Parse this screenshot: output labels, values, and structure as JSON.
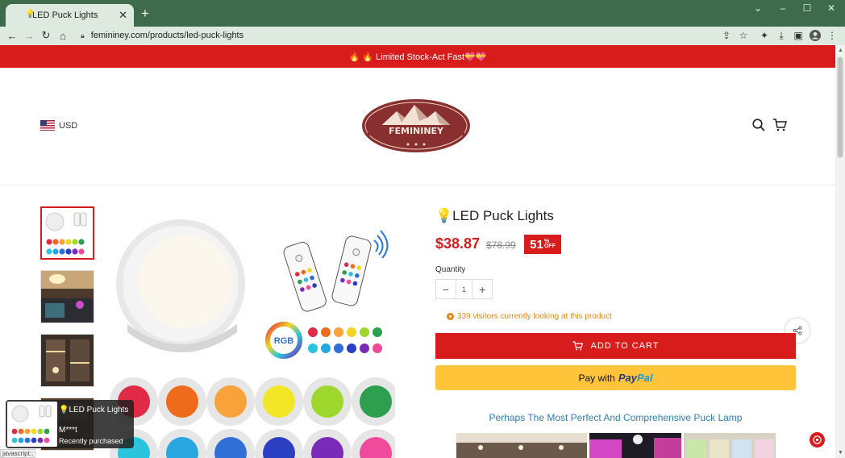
{
  "browser": {
    "tab_title": "LED Puck Lights",
    "tab_favicon": "💡",
    "url": "femininey.com/products/led-puck-lights",
    "status_text": "javascript:;"
  },
  "announcement": {
    "text": "🔥 🔥 Limited Stock-Act Fast💝💝"
  },
  "header": {
    "currency": "USD",
    "logo_text": "FEMININEY"
  },
  "product": {
    "title_icon": "💡",
    "title": "LED Puck Lights",
    "price": "$38.87",
    "compare_price": "$78.99",
    "discount_number": "51",
    "discount_percent": "%",
    "discount_off": "OFF",
    "quantity_label": "Quantity",
    "quantity_value": "1",
    "visitors_text": "339 visitors currently looking at this product",
    "add_to_cart": "ADD TO CART",
    "paypal_prefix": "Pay with",
    "paypal_brand_1": "Pay",
    "paypal_brand_2": "Pal",
    "blurb": "Perhaps The Most Perfect And Comprehensive Puck Lamp"
  },
  "popup": {
    "title": "💡LED Puck Lights",
    "user": "M***t",
    "action": "Recently purchased"
  },
  "image_labels": {
    "rgb": "RGB"
  },
  "colors": {
    "brand_red": "#d81b1b",
    "chrome_green": "#3f6b4d",
    "chrome_light": "#dee9df",
    "visitor_orange": "#e4891b",
    "paypal_yellow": "#ffc439",
    "link_blue": "#2d7fb8"
  }
}
